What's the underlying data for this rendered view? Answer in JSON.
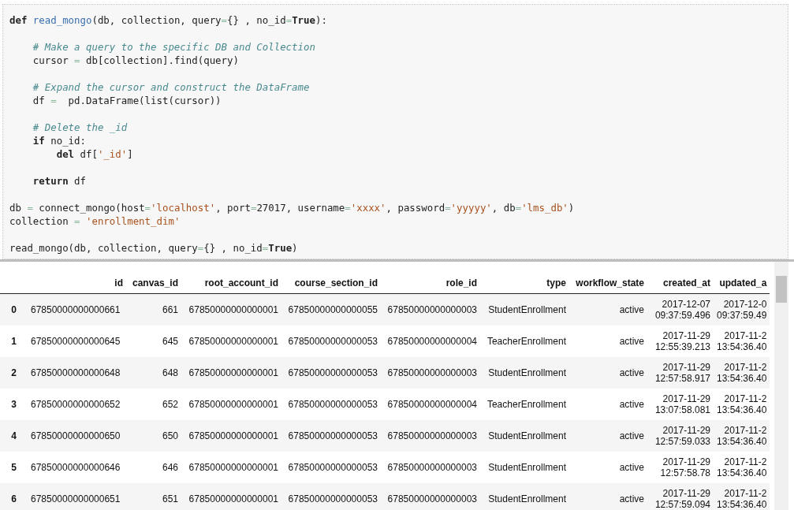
{
  "code_cell": {
    "blocks": [
      [
        [
          {
            "kind": "kw",
            "text": "def "
          },
          {
            "kind": "fn",
            "text": "read_mongo"
          },
          {
            "kind": "plain",
            "text": "(db, collection, query"
          },
          {
            "kind": "op",
            "text": "="
          },
          {
            "kind": "plain",
            "text": "{} , no_id"
          },
          {
            "kind": "op",
            "text": "="
          },
          {
            "kind": "kw",
            "text": "True"
          },
          {
            "kind": "plain",
            "text": "):"
          }
        ]
      ],
      [
        [
          {
            "kind": "cm",
            "text": "    # Make a query to the specific DB and Collection"
          }
        ],
        [
          {
            "kind": "plain",
            "text": "    cursor "
          },
          {
            "kind": "op",
            "text": "="
          },
          {
            "kind": "plain",
            "text": " db[collection].find(query)"
          }
        ]
      ],
      [
        [
          {
            "kind": "cm",
            "text": "    # Expand the cursor and construct the DataFrame"
          }
        ],
        [
          {
            "kind": "plain",
            "text": "    df "
          },
          {
            "kind": "op",
            "text": "="
          },
          {
            "kind": "plain",
            "text": "  pd.DataFrame(list(cursor))"
          }
        ]
      ],
      [
        [
          {
            "kind": "cm",
            "text": "    # Delete the _id"
          }
        ],
        [
          {
            "kind": "kw",
            "text": "    if"
          },
          {
            "kind": "plain",
            "text": " no_id:"
          }
        ],
        [
          {
            "kind": "kw",
            "text": "        del"
          },
          {
            "kind": "plain",
            "text": " df["
          },
          {
            "kind": "str",
            "text": "'_id'"
          },
          {
            "kind": "plain",
            "text": "]"
          }
        ]
      ],
      [
        [
          {
            "kind": "kw",
            "text": "    return"
          },
          {
            "kind": "plain",
            "text": " df"
          }
        ]
      ],
      [
        [
          {
            "kind": "plain",
            "text": "db "
          },
          {
            "kind": "op",
            "text": "="
          },
          {
            "kind": "plain",
            "text": " connect_mongo(host"
          },
          {
            "kind": "op",
            "text": "="
          },
          {
            "kind": "str",
            "text": "'localhost'"
          },
          {
            "kind": "plain",
            "text": ", port"
          },
          {
            "kind": "op",
            "text": "="
          },
          {
            "kind": "plain",
            "text": "27017, username"
          },
          {
            "kind": "op",
            "text": "="
          },
          {
            "kind": "str",
            "text": "'xxxx'"
          },
          {
            "kind": "plain",
            "text": ", password"
          },
          {
            "kind": "op",
            "text": "="
          },
          {
            "kind": "str",
            "text": "'yyyyy'"
          },
          {
            "kind": "plain",
            "text": ", db"
          },
          {
            "kind": "op",
            "text": "="
          },
          {
            "kind": "str",
            "text": "'lms_db'"
          },
          {
            "kind": "plain",
            "text": ")"
          }
        ],
        [
          {
            "kind": "plain",
            "text": "collection "
          },
          {
            "kind": "op",
            "text": "= "
          },
          {
            "kind": "str",
            "text": "'enrollment_dim'"
          }
        ]
      ],
      [
        [
          {
            "kind": "plain",
            "text": "read_mongo(db, collection, query"
          },
          {
            "kind": "op",
            "text": "="
          },
          {
            "kind": "plain",
            "text": "{} , no_id"
          },
          {
            "kind": "op",
            "text": "="
          },
          {
            "kind": "kw",
            "text": "True"
          },
          {
            "kind": "plain",
            "text": ")"
          }
        ]
      ]
    ]
  },
  "table": {
    "columns": [
      "id",
      "canvas_id",
      "root_account_id",
      "course_section_id",
      "role_id",
      "type",
      "workflow_state",
      "created_at",
      "updated_a"
    ],
    "rows": [
      {
        "index": "0",
        "cells": [
          "67850000000000661",
          "661",
          "67850000000000001",
          "67850000000000055",
          "67850000000000003",
          "StudentEnrollment",
          "active",
          "2017-12-07 09:37:59.496",
          "2017-12-0 09:37:59.49"
        ]
      },
      {
        "index": "1",
        "cells": [
          "67850000000000645",
          "645",
          "67850000000000001",
          "67850000000000053",
          "67850000000000004",
          "TeacherEnrollment",
          "active",
          "2017-11-29 12:55:39.213",
          "2017-11-2 13:54:36.40"
        ]
      },
      {
        "index": "2",
        "cells": [
          "67850000000000648",
          "648",
          "67850000000000001",
          "67850000000000053",
          "67850000000000003",
          "StudentEnrollment",
          "active",
          "2017-11-29 12:57:58.917",
          "2017-11-2 13:54:36.40"
        ]
      },
      {
        "index": "3",
        "cells": [
          "67850000000000652",
          "652",
          "67850000000000001",
          "67850000000000053",
          "67850000000000004",
          "TeacherEnrollment",
          "active",
          "2017-11-29 13:07:58.081",
          "2017-11-2 13:54:36.40"
        ]
      },
      {
        "index": "4",
        "cells": [
          "67850000000000650",
          "650",
          "67850000000000001",
          "67850000000000053",
          "67850000000000003",
          "StudentEnrollment",
          "active",
          "2017-11-29 12:57:59.033",
          "2017-11-2 13:54:36.40"
        ]
      },
      {
        "index": "5",
        "cells": [
          "67850000000000646",
          "646",
          "67850000000000001",
          "67850000000000053",
          "67850000000000003",
          "StudentEnrollment",
          "active",
          "2017-11-29 12:57:58.78",
          "2017-11-2 13:54:36.40"
        ]
      },
      {
        "index": "6",
        "cells": [
          "67850000000000651",
          "651",
          "67850000000000001",
          "67850000000000053",
          "67850000000000003",
          "StudentEnrollment",
          "active",
          "2017-11-29 12:57:59.094",
          "2017-11-2 13:54:36.40"
        ]
      }
    ]
  }
}
